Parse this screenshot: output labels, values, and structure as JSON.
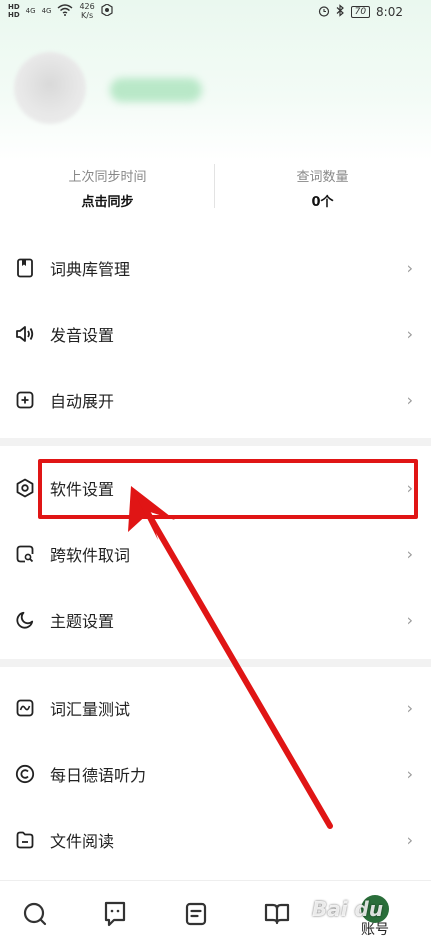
{
  "status_bar": {
    "hd1": "HD",
    "hd2": "HD",
    "net1": "4G",
    "net2": "4G",
    "speed_value": "426",
    "speed_unit": "K/s",
    "battery": "70",
    "time": "8:02"
  },
  "stats": {
    "sync_label": "上次同步时间",
    "sync_value": "点击同步",
    "lookup_label": "查词数量",
    "lookup_value": "0个"
  },
  "menu": [
    {
      "label": "词典库管理",
      "icon": "bookmark-book-icon"
    },
    {
      "label": "发音设置",
      "icon": "speaker-icon"
    },
    {
      "label": "自动展开",
      "icon": "plus-square-icon"
    },
    {
      "label": "软件设置",
      "icon": "hexagon-settings-icon"
    },
    {
      "label": "跨软件取词",
      "icon": "search-square-icon"
    },
    {
      "label": "主题设置",
      "icon": "moon-icon"
    },
    {
      "label": "词汇量测试",
      "icon": "wave-square-icon"
    },
    {
      "label": "每日德语听力",
      "icon": "copyright-circle-icon"
    },
    {
      "label": "文件阅读",
      "icon": "folder-icon"
    }
  ],
  "chevron": "›",
  "bottom_nav": {
    "account_label": "账号"
  },
  "watermark": "Bai du",
  "colors": {
    "highlight": "#e01515",
    "accent_green": "#2a6e3a"
  }
}
